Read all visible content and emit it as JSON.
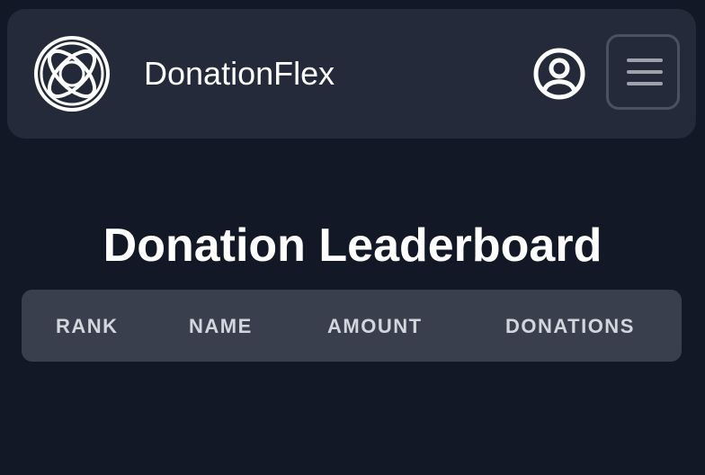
{
  "header": {
    "brand_name": "DonationFlex",
    "logo_icon": "circle-knot-logo-icon",
    "user_icon": "user-circle-icon",
    "menu_icon": "hamburger-menu-icon"
  },
  "main": {
    "title": "Donation Leaderboard",
    "table": {
      "columns": [
        "RANK",
        "NAME",
        "AMOUNT",
        "DONATIONS"
      ],
      "rows": []
    }
  },
  "colors": {
    "background": "#121826",
    "navbar": "#242a39",
    "table_header": "#3a3f4e",
    "text_primary": "#ffffff",
    "text_header": "#d3d6dd"
  }
}
